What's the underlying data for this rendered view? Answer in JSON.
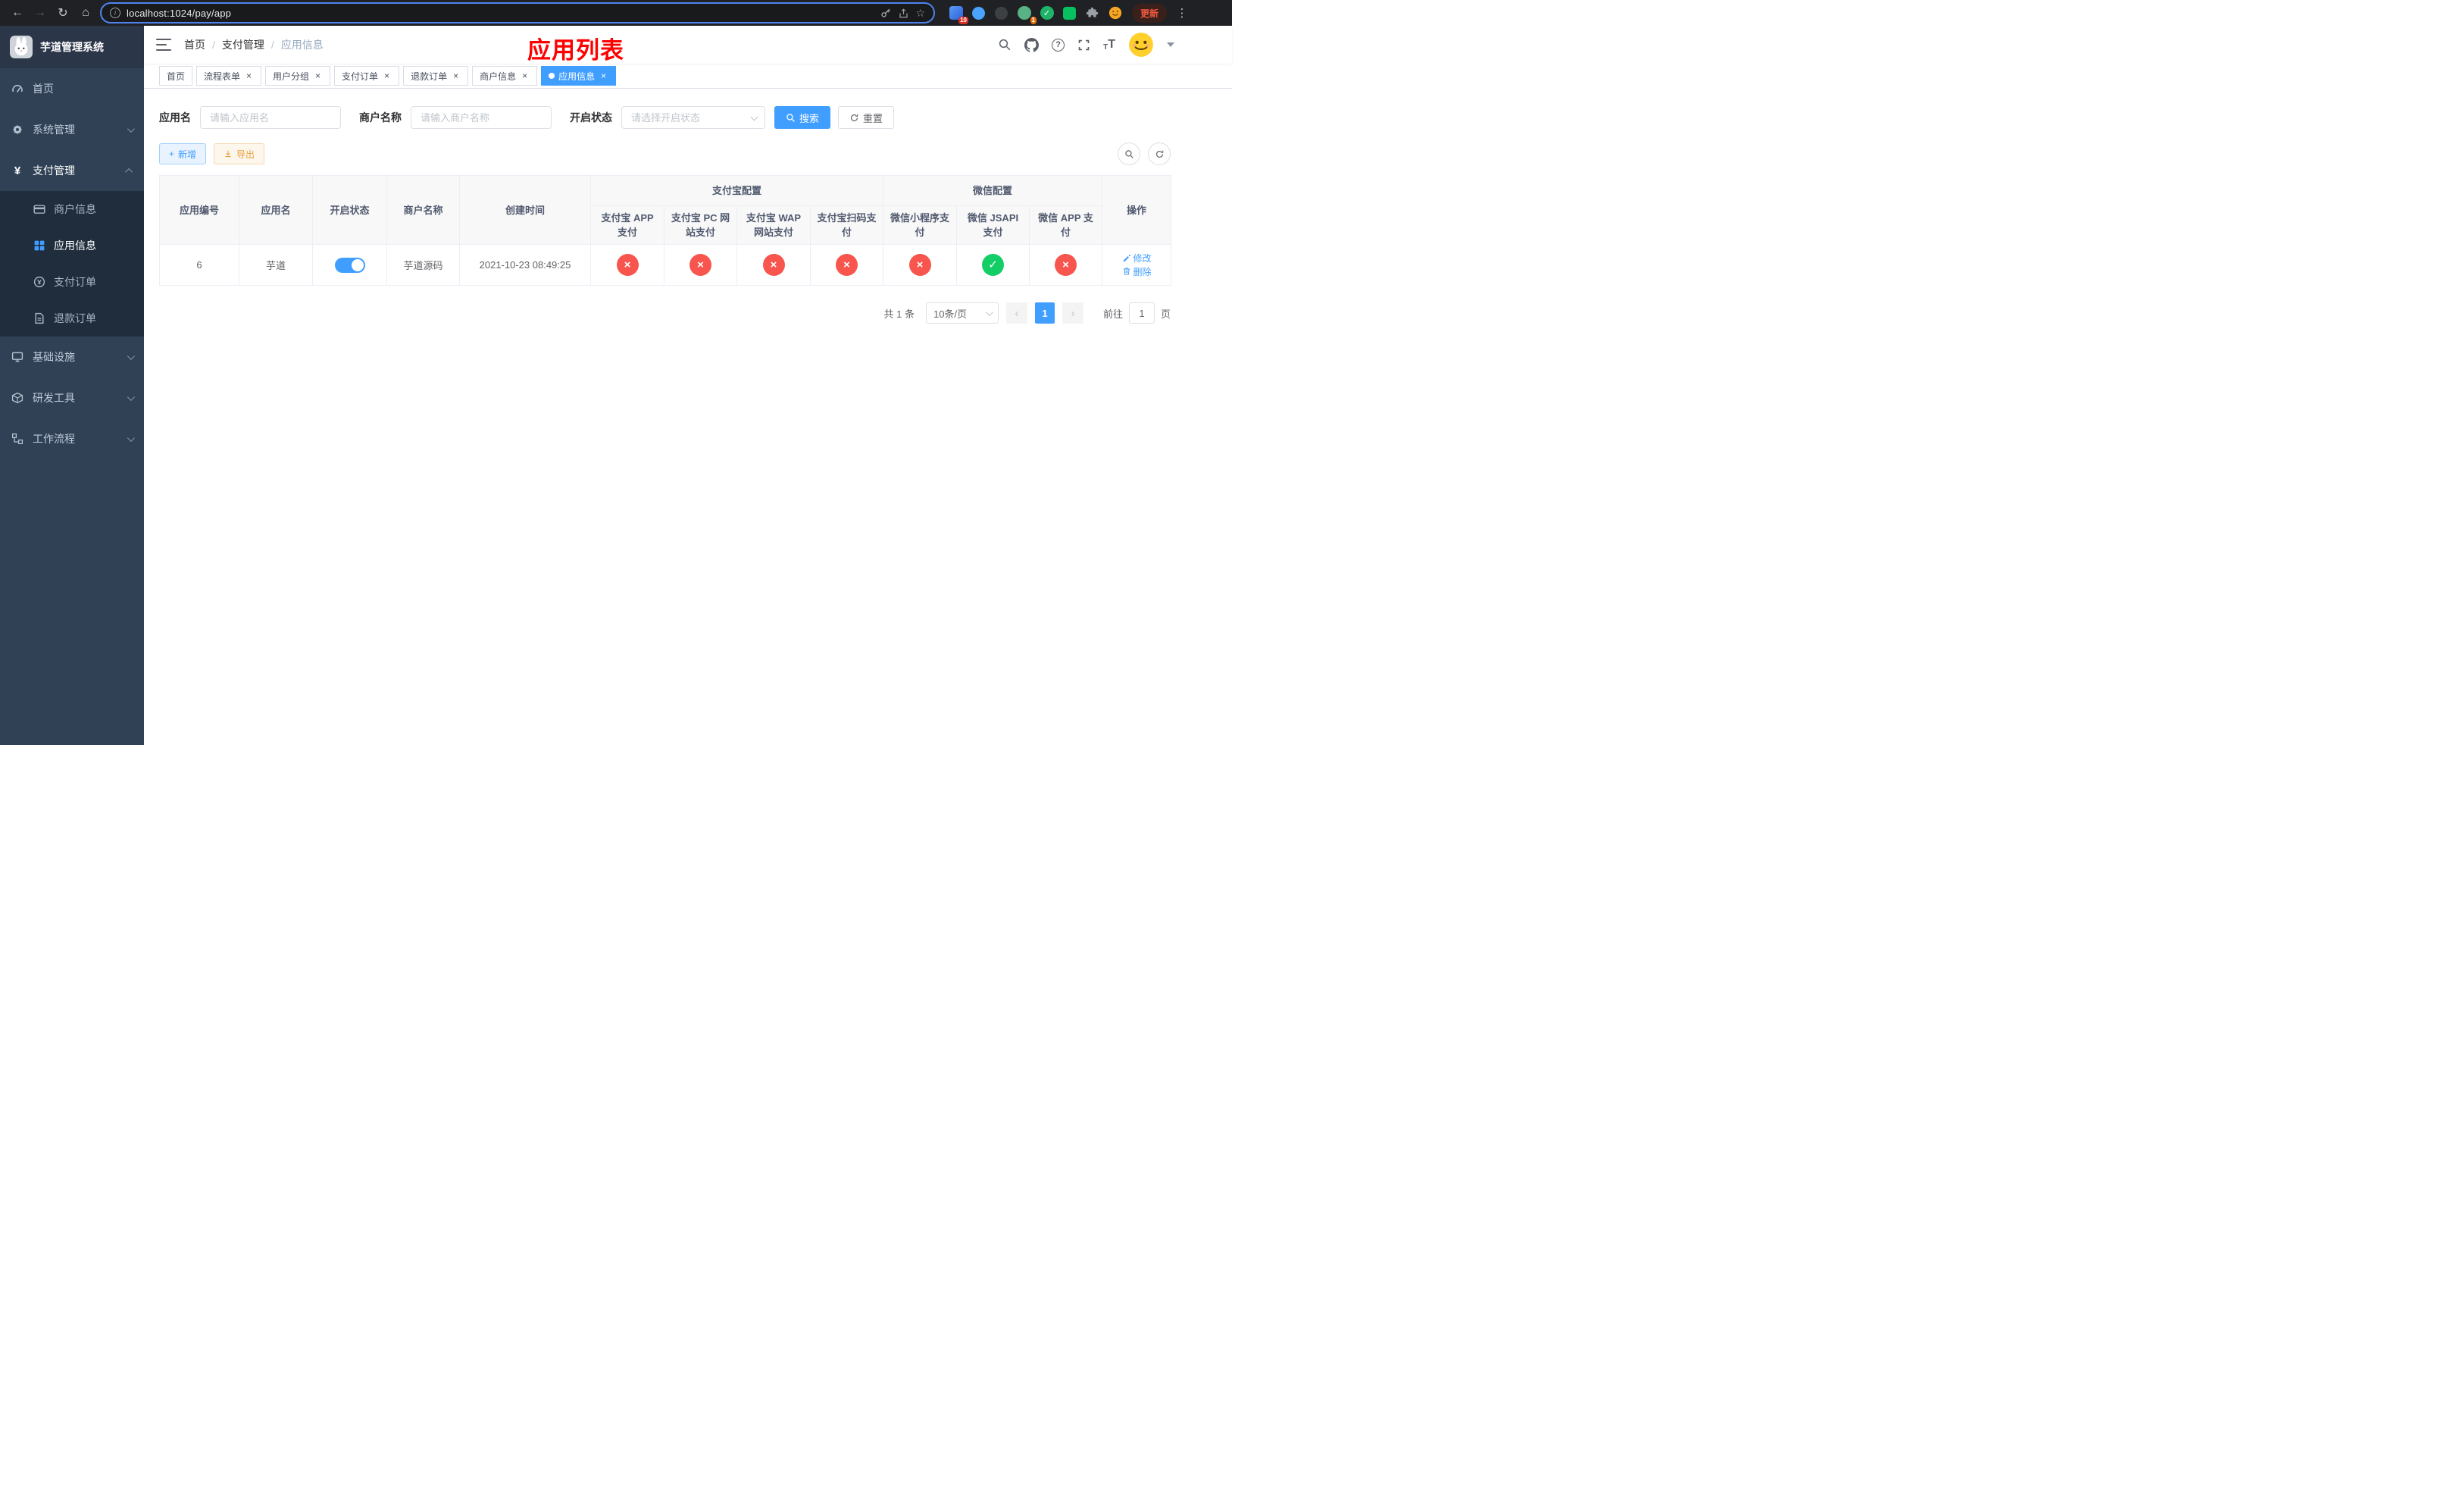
{
  "browser": {
    "url": "localhost:1024/pay/app",
    "update_button": "更新",
    "ext_badge_1": "10",
    "ext_badge_2": "1"
  },
  "icons": {
    "back": "←",
    "forward": "→",
    "refresh": "↻",
    "home": "⌂",
    "star": "☆",
    "dots": "⋮",
    "close": "×",
    "check": "✓",
    "cross": "×",
    "question": "?",
    "info": "i",
    "yen": "¥",
    "prev": "‹",
    "next": "›",
    "plus": "+",
    "letter": "T"
  },
  "sidebar": {
    "title": "芋道管理系统",
    "items": [
      {
        "label": "首页"
      },
      {
        "label": "系统管理"
      },
      {
        "label": "支付管理"
      },
      {
        "label": "基础设施"
      },
      {
        "label": "研发工具"
      },
      {
        "label": "工作流程"
      }
    ],
    "submenu": [
      {
        "label": "商户信息"
      },
      {
        "label": "应用信息"
      },
      {
        "label": "支付订单"
      },
      {
        "label": "退款订单"
      }
    ]
  },
  "navbar": {
    "breadcrumb": [
      "首页",
      "支付管理",
      "应用信息"
    ],
    "annotation": "应用列表"
  },
  "tabs": [
    {
      "label": "首页"
    },
    {
      "label": "流程表单"
    },
    {
      "label": "用户分组"
    },
    {
      "label": "支付订单"
    },
    {
      "label": "退款订单"
    },
    {
      "label": "商户信息"
    },
    {
      "label": "应用信息"
    }
  ],
  "filters": {
    "app_name_label": "应用名",
    "app_name_placeholder": "请输入应用名",
    "merchant_label": "商户名称",
    "merchant_placeholder": "请输入商户名称",
    "status_label": "开启状态",
    "status_placeholder": "请选择开启状态",
    "search_label": "搜索",
    "reset_label": "重置"
  },
  "toolbar": {
    "add_label": "新增",
    "export_label": "导出"
  },
  "table": {
    "group_alipay": "支付宝配置",
    "group_wechat": "微信配置",
    "col_id": "应用编号",
    "col_name": "应用名",
    "col_status": "开启状态",
    "col_merchant": "商户名称",
    "col_created": "创建时间",
    "col_alipay_app": "支付宝 APP 支付",
    "col_alipay_pc": "支付宝 PC 网站支付",
    "col_alipay_wap": "支付宝 WAP 网站支付",
    "col_alipay_qr": "支付宝扫码支付",
    "col_wx_mini": "微信小程序支付",
    "col_wx_jsapi": "微信 JSAPI 支付",
    "col_wx_app": "微信 APP 支付",
    "col_op": "操作",
    "row": {
      "id": "6",
      "name": "芋道",
      "enabled": true,
      "merchant": "芋道源码",
      "created": "2021-10-23 08:49:25",
      "configs": [
        "no",
        "no",
        "no",
        "no",
        "no",
        "yes",
        "no"
      ],
      "action_edit": "修改",
      "action_delete": "删除"
    }
  },
  "pagination": {
    "total": "共 1 条",
    "page_size": "10条/页",
    "page": "1",
    "goto_label": "前往",
    "goto_value": "1",
    "unit_label": "页"
  },
  "colors": {
    "accent": "#409eff",
    "success": "#13ce66",
    "danger": "#f7554d",
    "warning": "#e6a23c",
    "annotation": "#ff0000",
    "sidebar_bg": "#304156"
  }
}
